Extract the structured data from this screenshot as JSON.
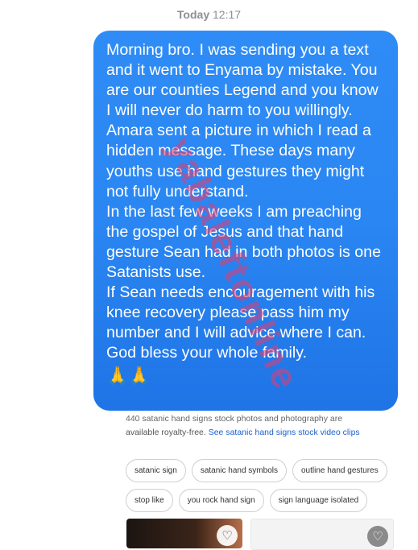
{
  "timestamp": {
    "day": "Today",
    "time": "12:17"
  },
  "message": {
    "paragraphs": [
      "Morning bro. I was sending you a text and it went to Enyama by mistake. You are our counties Legend and you know I will never do harm to you willingly.",
      "Amara sent a picture in which I read a hidden message. These days many youths use hand gestures they might not fully understand.",
      "In the last few weeks I am preaching the gospel of Jesus and that hand gesture Sean had in both photos is one Satanists use.",
      "If Sean needs encouragement with his knee recovery please pass him my number and I will advice where I can. God bless your whole family."
    ],
    "emoji": "🙏🙏"
  },
  "watermark": "yabaleftonline",
  "search": {
    "cut_text": "440 satanic hand signs stock photos and photography are",
    "text": "available royalty-free.",
    "link": "See satanic hand signs stock video clips",
    "chips_row1": [
      "satanic sign",
      "satanic hand symbols",
      "outline hand gestures"
    ],
    "chips_row2": [
      "stop like",
      "you rock hand sign",
      "sign language isolated"
    ]
  },
  "icons": {
    "favorite": "heart-icon"
  },
  "colors": {
    "bubble": "#2a86f2",
    "link": "#1a5fd0"
  }
}
